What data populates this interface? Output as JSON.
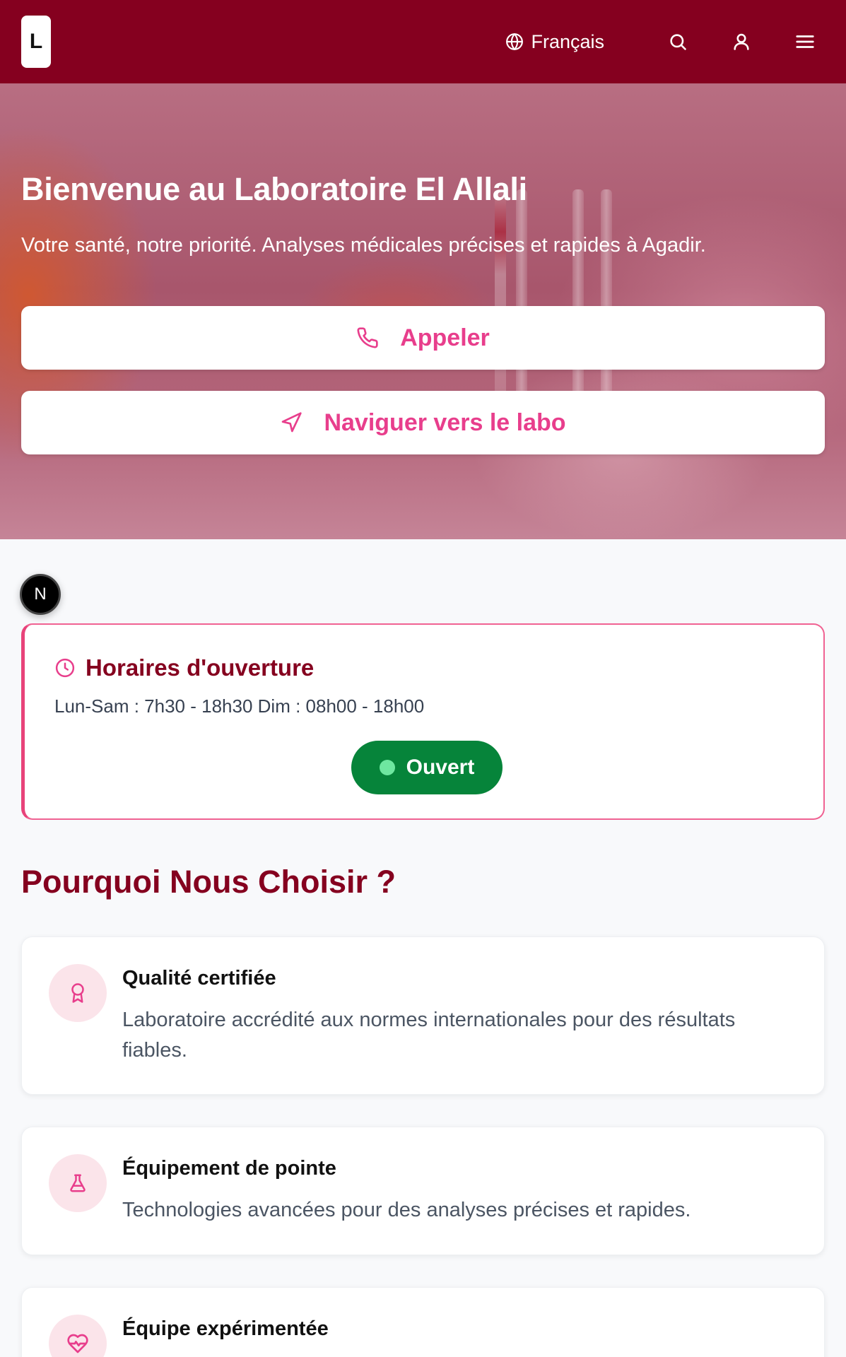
{
  "header": {
    "logo_letter": "L",
    "language": "Français",
    "icons": [
      "globe-icon",
      "search-icon",
      "user-icon",
      "menu-icon"
    ],
    "brand_color": "#85001f"
  },
  "hero": {
    "title": "Bienvenue au Laboratoire El Allali",
    "subtitle": "Votre santé, notre priorité. Analyses médicales précises et rapides à Agadir.",
    "call_label": "Appeler",
    "navigate_label": "Naviguer vers le labo",
    "accent_color": "#e83e8c"
  },
  "badge": {
    "letter": "N"
  },
  "hours": {
    "title": "Horaires d'ouverture",
    "text": "Lun-Sam : 7h30 - 18h30 Dim : 08h00 - 18h00",
    "status": "Ouvert",
    "status_color": "#06843a"
  },
  "why": {
    "title": "Pourquoi Nous Choisir ?",
    "features": [
      {
        "icon": "award-icon",
        "title": "Qualité certifiée",
        "description": "Laboratoire accrédité aux normes internationales pour des résultats fiables."
      },
      {
        "icon": "flask-icon",
        "title": "Équipement de pointe",
        "description": "Technologies avancées pour des analyses précises et rapides."
      },
      {
        "icon": "heart-pulse-icon",
        "title": "Équipe expérimentée",
        "description": ""
      }
    ]
  }
}
